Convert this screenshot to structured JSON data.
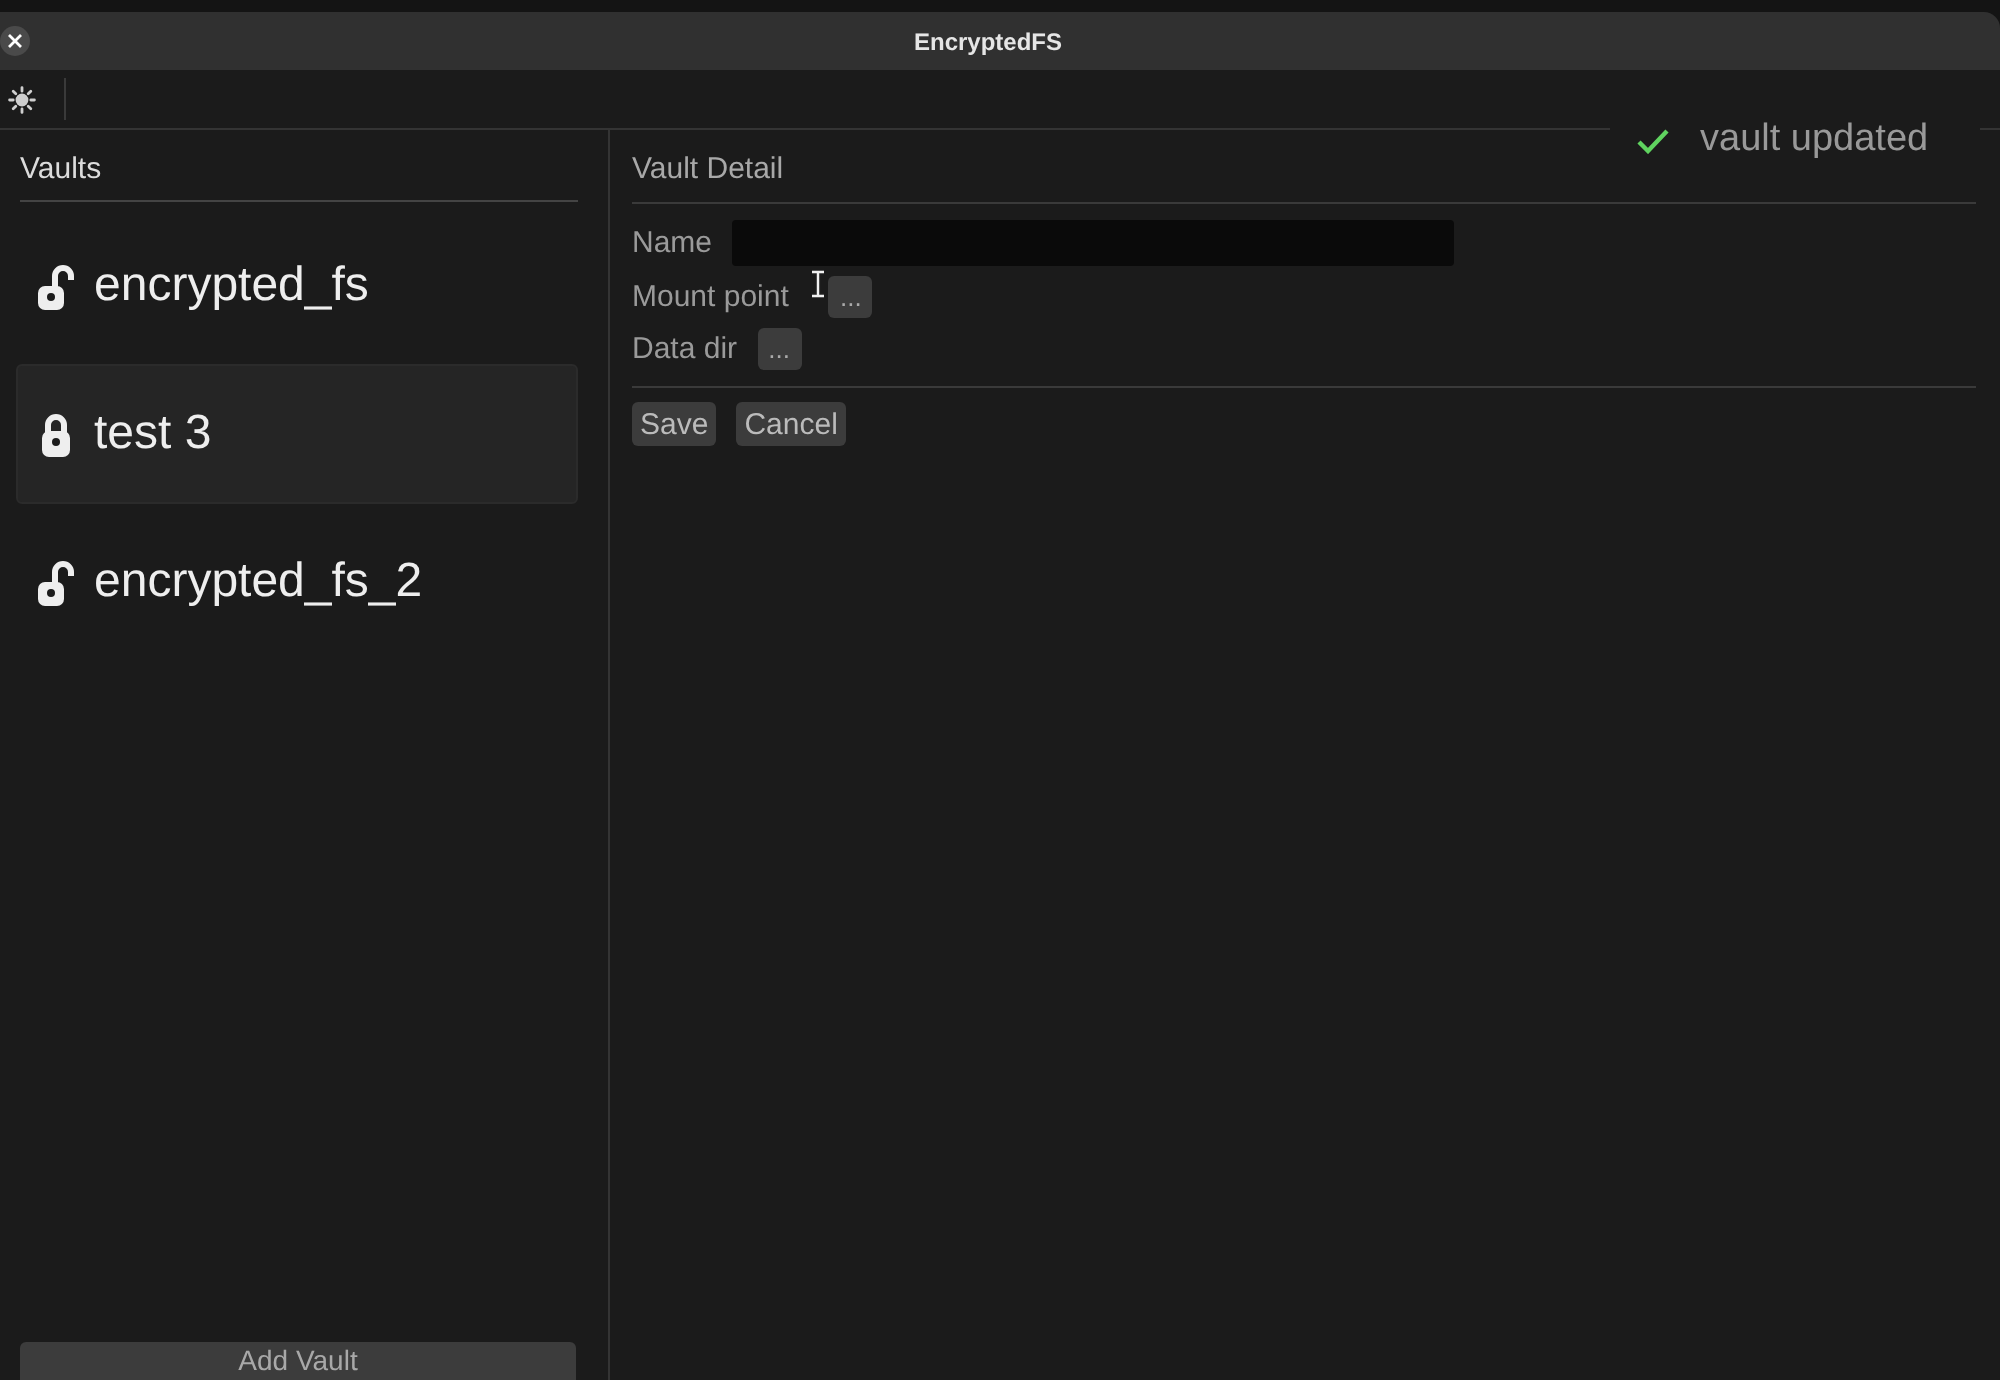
{
  "window": {
    "title": "EncryptedFS"
  },
  "vaults": {
    "heading": "Vaults",
    "items": [
      {
        "name": "encrypted_fs",
        "locked": false,
        "selected": false
      },
      {
        "name": "test 3",
        "locked": true,
        "selected": true
      },
      {
        "name": "encrypted_fs_2",
        "locked": false,
        "selected": false
      }
    ],
    "add_button": "Add Vault"
  },
  "detail": {
    "heading": "Vault Detail",
    "fields": [
      {
        "kind": "text",
        "label": "Name"
      },
      {
        "kind": "browse",
        "label": "Mount point",
        "button": "..."
      },
      {
        "kind": "browse",
        "label": "Data dir",
        "button": "..."
      }
    ],
    "buttons": [
      "Save",
      "Cancel"
    ]
  },
  "toast": {
    "message": "vault updated"
  }
}
